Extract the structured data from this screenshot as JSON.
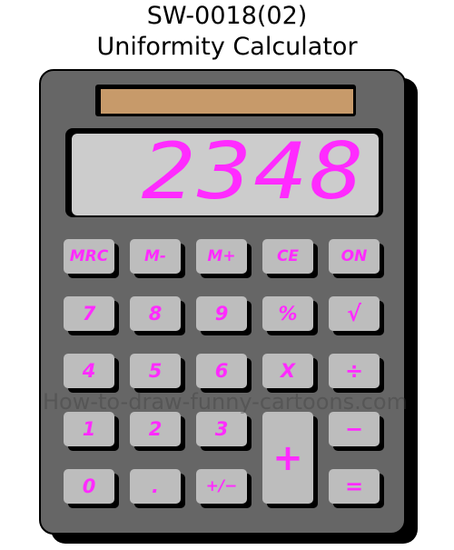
{
  "header": {
    "line1": "SW-0018(02)",
    "line2": "Uniformity Calculator"
  },
  "display": {
    "value": "2348"
  },
  "keys": {
    "mrc": "MRC",
    "m_minus": "M-",
    "m_plus": "M+",
    "ce": "CE",
    "on": "ON",
    "k7": "7",
    "k8": "8",
    "k9": "9",
    "percent": "%",
    "sqrt": "√",
    "k4": "4",
    "k5": "5",
    "k6": "6",
    "multiply": "X",
    "divide": "÷",
    "k1": "1",
    "k2": "2",
    "k3": "3",
    "minus": "−",
    "k0": "0",
    "dot": ".",
    "plusminus": "+/−",
    "plus": "+",
    "equals": "="
  },
  "watermark": "How-to-draw-funny-cartoons.com",
  "colors": {
    "body": "#666666",
    "key": "#bdbdbd",
    "label": "#ff2bff",
    "lcd": "#cccccc",
    "solar": "#c79a6a"
  }
}
